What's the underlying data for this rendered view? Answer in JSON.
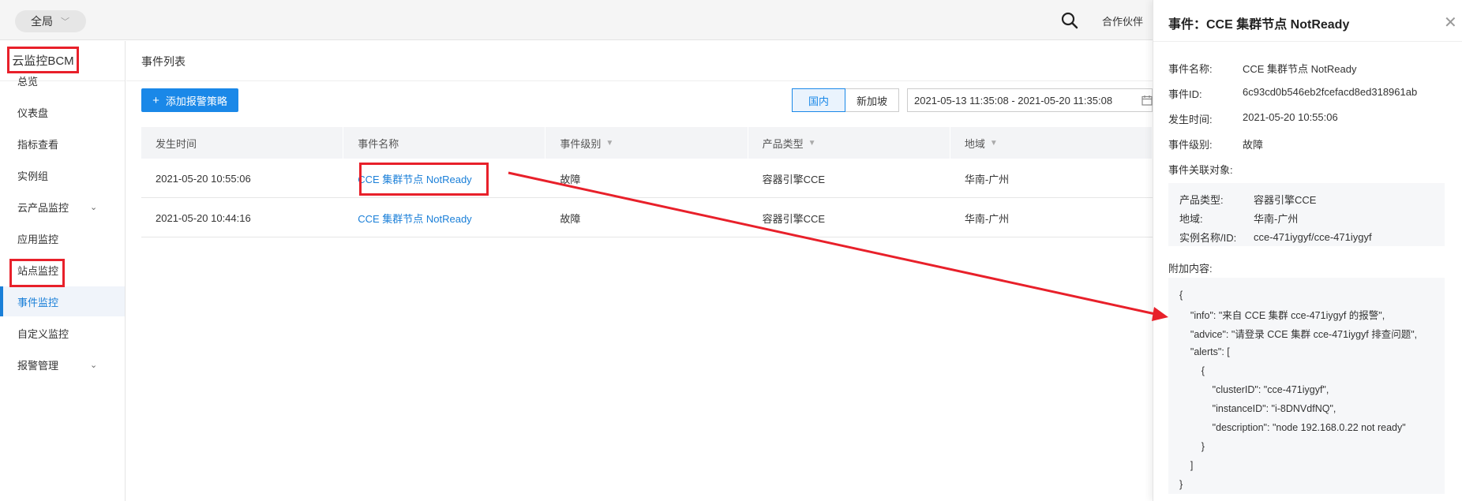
{
  "topbar": {
    "region": "全局",
    "partner": "合作伙伴"
  },
  "sidebar": {
    "title": "云监控BCM",
    "items": [
      {
        "label": "总览",
        "caret": false
      },
      {
        "label": "仪表盘",
        "caret": false
      },
      {
        "label": "指标查看",
        "caret": false
      },
      {
        "label": "实例组",
        "caret": false
      },
      {
        "label": "云产品监控",
        "caret": true
      },
      {
        "label": "应用监控",
        "caret": false
      },
      {
        "label": "站点监控",
        "caret": false
      },
      {
        "label": "事件监控",
        "caret": false,
        "active": true
      },
      {
        "label": "自定义监控",
        "caret": false
      },
      {
        "label": "报警管理",
        "caret": true
      }
    ]
  },
  "main": {
    "page_title": "事件列表",
    "add_button": "添加报警策略",
    "seg_domestic": "国内",
    "seg_singapore": "新加坡",
    "date_range": "2021-05-13 11:35:08 - 2021-05-20 11:35:08",
    "columns": [
      "发生时间",
      "事件名称",
      "事件级别",
      "产品类型",
      "地域"
    ],
    "rows": [
      {
        "time": "2021-05-20 10:55:06",
        "name": "CCE 集群节点 NotReady",
        "level": "故障",
        "product": "容器引擎CCE",
        "region": "华南-广州"
      },
      {
        "time": "2021-05-20 10:44:16",
        "name": "CCE 集群节点 NotReady",
        "level": "故障",
        "product": "容器引擎CCE",
        "region": "华南-广州"
      }
    ]
  },
  "drawer": {
    "title": "事件：CCE 集群节点 NotReady",
    "fields": {
      "name_label": "事件名称:",
      "name_value": "CCE 集群节点 NotReady",
      "id_label": "事件ID:",
      "id_value": "6c93cd0b546eb2fcefacd8ed318961ab",
      "time_label": "发生时间:",
      "time_value": "2021-05-20 10:55:06",
      "level_label": "事件级别:",
      "level_value": "故障"
    },
    "related_label": "事件关联对象:",
    "related": {
      "product_label": "产品类型:",
      "product_value": "容器引擎CCE",
      "region_label": "地域:",
      "region_value": "华南-广州",
      "instance_label": "实例名称/ID:",
      "instance_value": "cce-471iygyf/cce-471iygyf"
    },
    "extra_label": "附加内容:",
    "code_lines": [
      "{",
      "    \"info\": \"来自 CCE 集群 cce-471iygyf 的报警\",",
      "    \"advice\": \"请登录 CCE 集群 cce-471iygyf 排查问题\",",
      "    \"alerts\": [",
      "        {",
      "            \"clusterID\": \"cce-471iygyf\",",
      "            \"instanceID\": \"i-8DNVdfNQ\",",
      "            \"description\": \"node 192.168.0.22 not ready\"",
      "        }",
      "    ]",
      "}"
    ]
  },
  "colors": {
    "accent": "#1a88e8",
    "annotation": "#e8202a"
  }
}
